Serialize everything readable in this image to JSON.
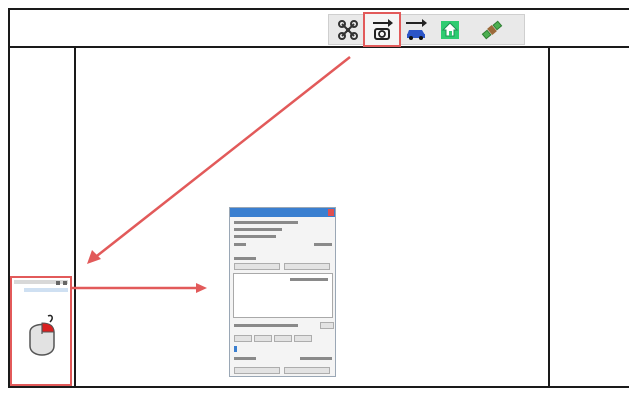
{
  "toolbar": {
    "icons": [
      "drone-icon",
      "camera-arrow-icon",
      "car-arrow-icon",
      "house-icon",
      "satellite-icon"
    ],
    "active_index": 1
  },
  "colors": {
    "highlight": "#e25a5a",
    "frame": "#1a1a1a",
    "toolbar_bg": "#e9e9e9",
    "dialog_title": "#3a7fd0"
  },
  "small_panel": {
    "icon": "mouse-icon",
    "mouse_button_highlight": "#d92020"
  },
  "dialog": {
    "title_bar_color": "#3a7fd0"
  }
}
